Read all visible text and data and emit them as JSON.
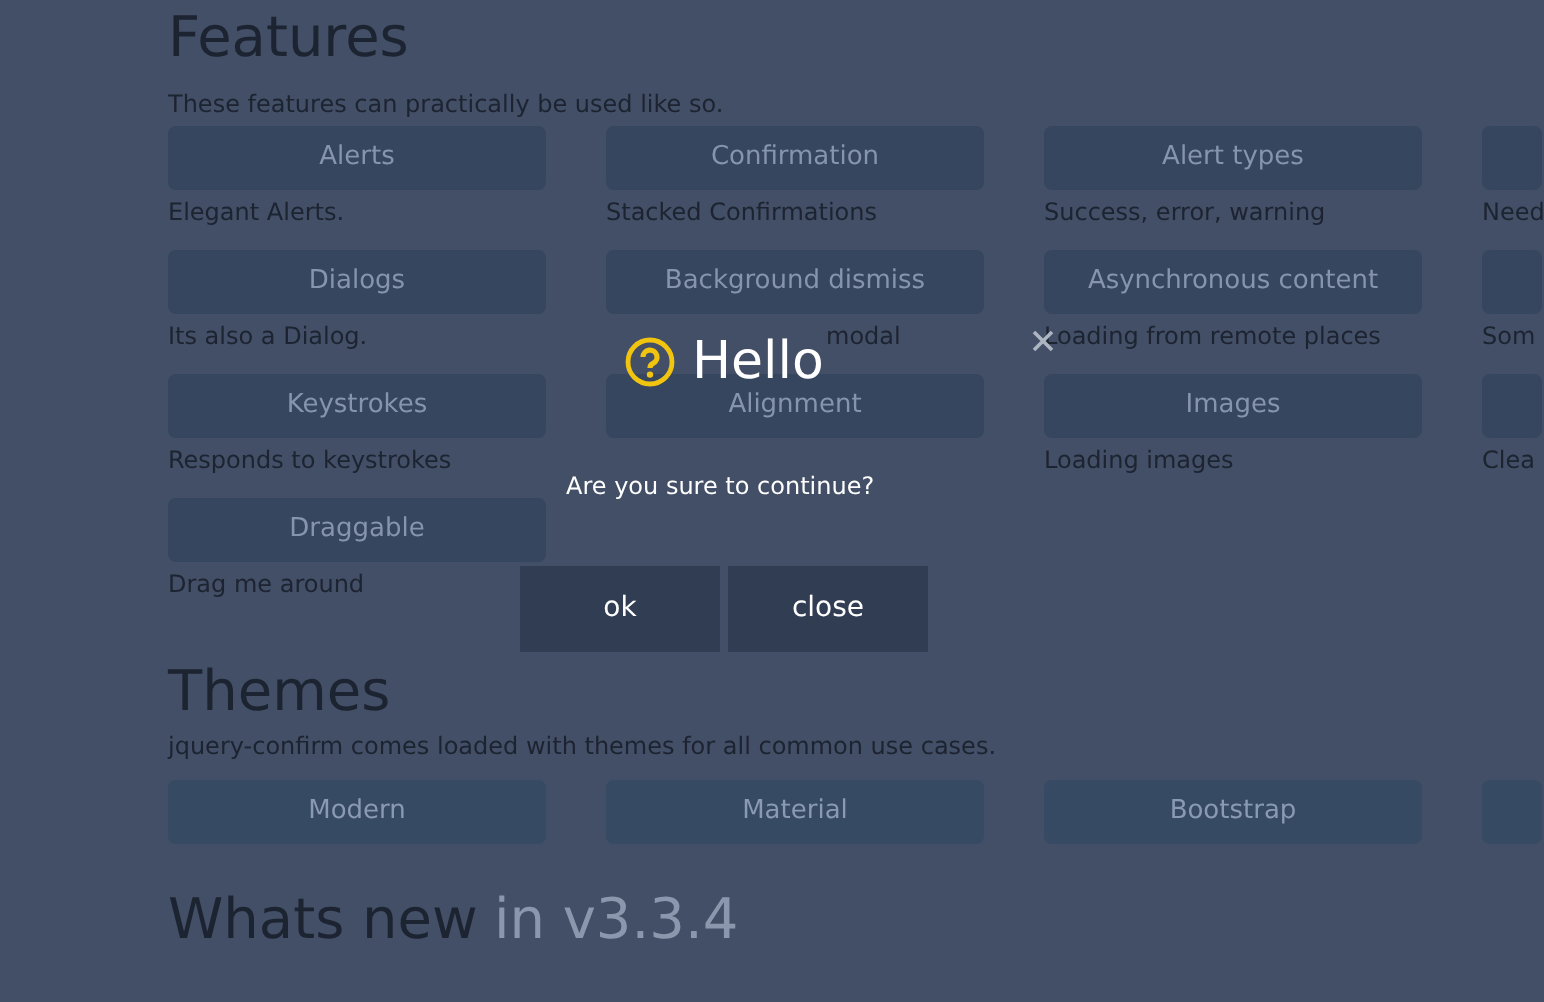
{
  "features": {
    "title": "Features",
    "subtitle": "These features can practically be used like so.",
    "items": [
      {
        "button": "Alerts",
        "description": "Elegant Alerts."
      },
      {
        "button": "Confirmation",
        "description": "Stacked Confirmations"
      },
      {
        "button": "Alert types",
        "description": "Success, error, warning"
      },
      {
        "description": "Need"
      },
      {
        "button": "Dialogs",
        "description": "Its also a Dialog."
      },
      {
        "button": "Background dismiss",
        "description": "modal"
      },
      {
        "button": "Asynchronous content",
        "description": "Loading from remote places"
      },
      {
        "description": "Som"
      },
      {
        "button": "Keystrokes",
        "description": "Responds to keystrokes"
      },
      {
        "button": "Alignment"
      },
      {
        "button": "Images",
        "description": "Loading images"
      },
      {
        "description": "Clea"
      },
      {
        "button": "Draggable",
        "description": "Drag me around"
      }
    ]
  },
  "themes": {
    "title": "Themes",
    "subtitle": "jquery-confirm comes loaded with themes for all common use cases.",
    "buttons": [
      {
        "label": "Modern"
      },
      {
        "label": "Material"
      },
      {
        "label": "Bootstrap"
      },
      {
        "kind": "blank"
      }
    ]
  },
  "whats_new": {
    "title": "Whats new",
    "version": "in v3.3.4"
  },
  "dialog": {
    "title": "Hello",
    "content": "Are you sure to continue?",
    "buttons": [
      "ok",
      "close"
    ]
  }
}
